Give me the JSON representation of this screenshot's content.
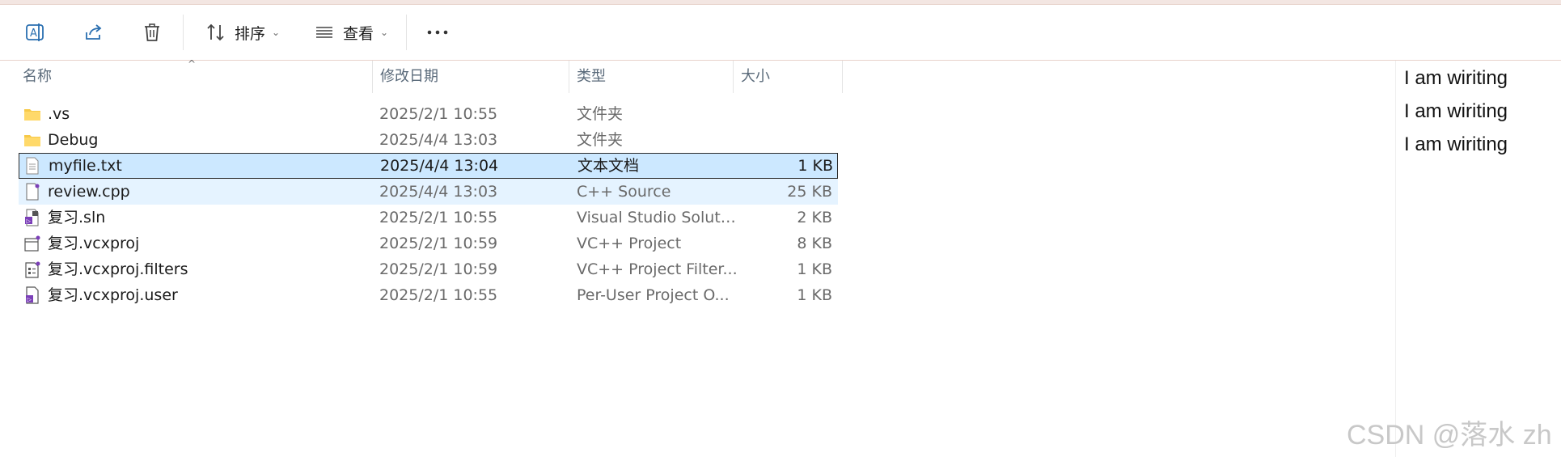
{
  "toolbar": {
    "sort_label": "排序",
    "view_label": "查看"
  },
  "columns": {
    "name": "名称",
    "date": "修改日期",
    "type": "类型",
    "size": "大小"
  },
  "files": [
    {
      "name": ".vs",
      "date": "2025/2/1 10:55",
      "type": "文件夹",
      "size": "",
      "icon": "folder-icon"
    },
    {
      "name": "Debug",
      "date": "2025/4/4 13:03",
      "type": "文件夹",
      "size": "",
      "icon": "folder-icon"
    },
    {
      "name": "myfile.txt",
      "date": "2025/4/4 13:04",
      "type": "文本文档",
      "size": "1 KB",
      "icon": "text-file-icon",
      "state": "selected"
    },
    {
      "name": "review.cpp",
      "date": "2025/4/4 13:03",
      "type": "C++ Source",
      "size": "25 KB",
      "icon": "cpp-file-icon",
      "state": "hover"
    },
    {
      "name": "复习.sln",
      "date": "2025/2/1 10:55",
      "type": "Visual Studio Soluti...",
      "size": "2 KB",
      "icon": "solution-file-icon"
    },
    {
      "name": "复习.vcxproj",
      "date": "2025/2/1 10:59",
      "type": "VC++ Project",
      "size": "8 KB",
      "icon": "project-file-icon"
    },
    {
      "name": "复习.vcxproj.filters",
      "date": "2025/2/1 10:59",
      "type": "VC++ Project Filter...",
      "size": "1 KB",
      "icon": "filters-file-icon"
    },
    {
      "name": "复习.vcxproj.user",
      "date": "2025/2/1 10:55",
      "type": "Per-User Project O...",
      "size": "1 KB",
      "icon": "user-file-icon"
    }
  ],
  "preview": {
    "lines": [
      "I am wiriting",
      "I am wiriting",
      "I am wiriting"
    ]
  },
  "watermark": "CSDN @落水 zh",
  "colors": {
    "selection": "#cce8ff",
    "hover": "#e5f3ff",
    "folder": "#f7c948"
  }
}
